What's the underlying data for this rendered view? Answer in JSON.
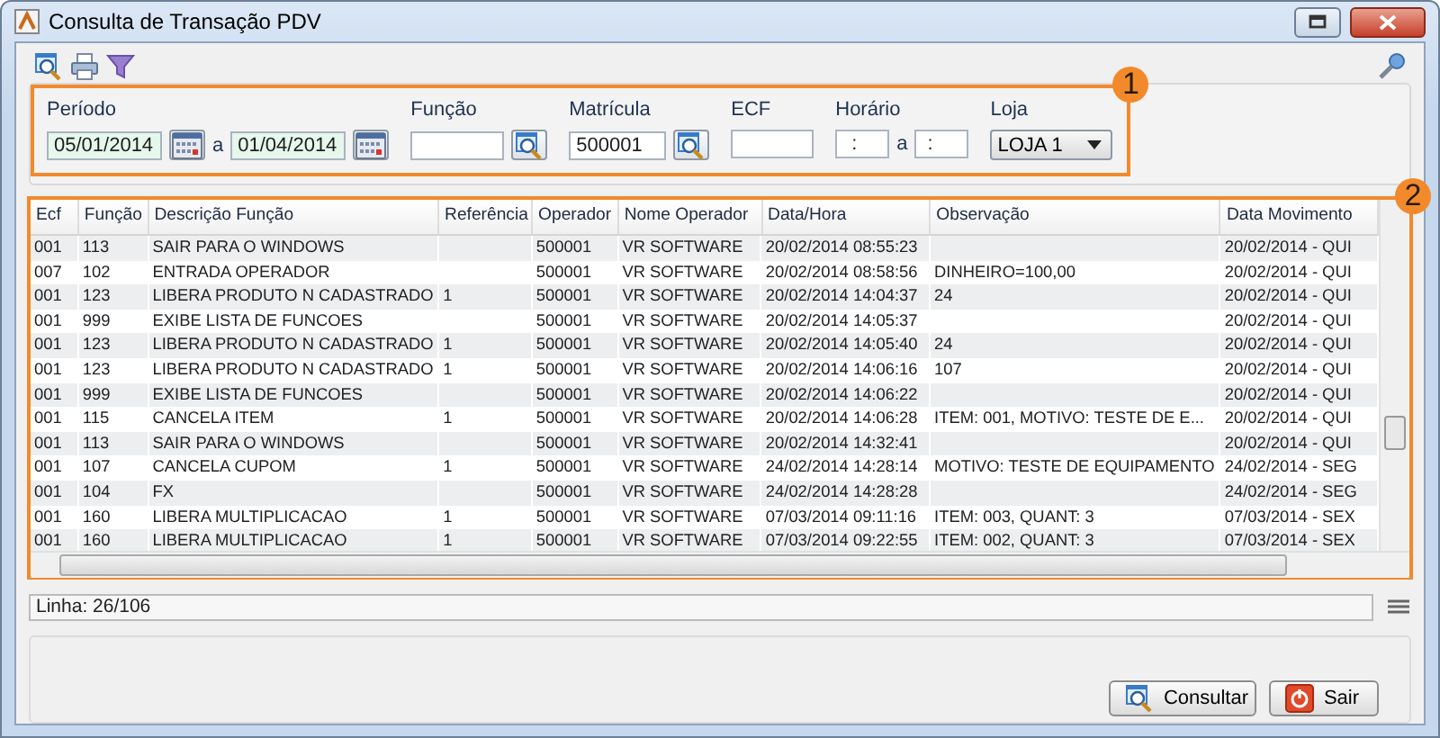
{
  "window": {
    "title": "Consulta de Transação PDV"
  },
  "filters": {
    "callout": "1",
    "period": {
      "label": "Período",
      "from": "05/01/2014",
      "separator": "a",
      "to": "01/04/2014"
    },
    "function": {
      "label": "Função"
    },
    "registration": {
      "label": "Matrícula",
      "value": "500001"
    },
    "ecf": {
      "label": "ECF"
    },
    "time": {
      "label": "Horário",
      "from": ":",
      "separator": "a",
      "to": ":"
    },
    "store": {
      "label": "Loja",
      "value": "LOJA 1"
    }
  },
  "table": {
    "callout": "2",
    "columns": [
      "Ecf",
      "Função",
      "Descrição Função",
      "Referência",
      "Operador",
      "Nome Operador",
      "Data/Hora",
      "Observação",
      "Data Movimento"
    ],
    "rows": [
      [
        "001",
        "113",
        "SAIR PARA O WINDOWS",
        "",
        "500001",
        "VR SOFTWARE",
        "20/02/2014 08:55:23",
        "",
        "20/02/2014 - QUI"
      ],
      [
        "007",
        "102",
        "ENTRADA OPERADOR",
        "",
        "500001",
        "VR SOFTWARE",
        "20/02/2014 08:58:56",
        "DINHEIRO=100,00",
        "20/02/2014 - QUI"
      ],
      [
        "001",
        "123",
        "LIBERA PRODUTO N CADASTRADO",
        "1",
        "500001",
        "VR SOFTWARE",
        "20/02/2014 14:04:37",
        "24",
        "20/02/2014 - QUI"
      ],
      [
        "001",
        "999",
        "EXIBE LISTA DE FUNCOES",
        "",
        "500001",
        "VR SOFTWARE",
        "20/02/2014 14:05:37",
        "",
        "20/02/2014 - QUI"
      ],
      [
        "001",
        "123",
        "LIBERA PRODUTO N CADASTRADO",
        "1",
        "500001",
        "VR SOFTWARE",
        "20/02/2014 14:05:40",
        "24",
        "20/02/2014 - QUI"
      ],
      [
        "001",
        "123",
        "LIBERA PRODUTO N CADASTRADO",
        "1",
        "500001",
        "VR SOFTWARE",
        "20/02/2014 14:06:16",
        "107",
        "20/02/2014 - QUI"
      ],
      [
        "001",
        "999",
        "EXIBE LISTA DE FUNCOES",
        "",
        "500001",
        "VR SOFTWARE",
        "20/02/2014 14:06:22",
        "",
        "20/02/2014 - QUI"
      ],
      [
        "001",
        "115",
        "CANCELA ITEM",
        "1",
        "500001",
        "VR SOFTWARE",
        "20/02/2014 14:06:28",
        "ITEM: 001, MOTIVO: TESTE DE E...",
        "20/02/2014 - QUI"
      ],
      [
        "001",
        "113",
        "SAIR PARA O WINDOWS",
        "",
        "500001",
        "VR SOFTWARE",
        "20/02/2014 14:32:41",
        "",
        "20/02/2014 - QUI"
      ],
      [
        "001",
        "107",
        "CANCELA CUPOM",
        "1",
        "500001",
        "VR SOFTWARE",
        "24/02/2014 14:28:14",
        "MOTIVO: TESTE DE EQUIPAMENTO",
        "24/02/2014 - SEG"
      ],
      [
        "001",
        "104",
        "FX",
        "",
        "500001",
        "VR SOFTWARE",
        "24/02/2014 14:28:28",
        "",
        "24/02/2014 - SEG"
      ],
      [
        "001",
        "160",
        "LIBERA MULTIPLICACAO",
        "1",
        "500001",
        "VR SOFTWARE",
        "07/03/2014 09:11:16",
        "ITEM: 003,  QUANT: 3",
        "07/03/2014 - SEX"
      ],
      [
        "001",
        "160",
        "LIBERA MULTIPLICACAO",
        "1",
        "500001",
        "VR SOFTWARE",
        "07/03/2014 09:22:55",
        "ITEM: 002,  QUANT: 3",
        "07/03/2014 - SEX"
      ]
    ]
  },
  "status": "Linha: 26/106",
  "buttons": [
    {
      "label": "Consultar",
      "kind": "search"
    },
    {
      "label": "Sair",
      "kind": "exit"
    }
  ]
}
